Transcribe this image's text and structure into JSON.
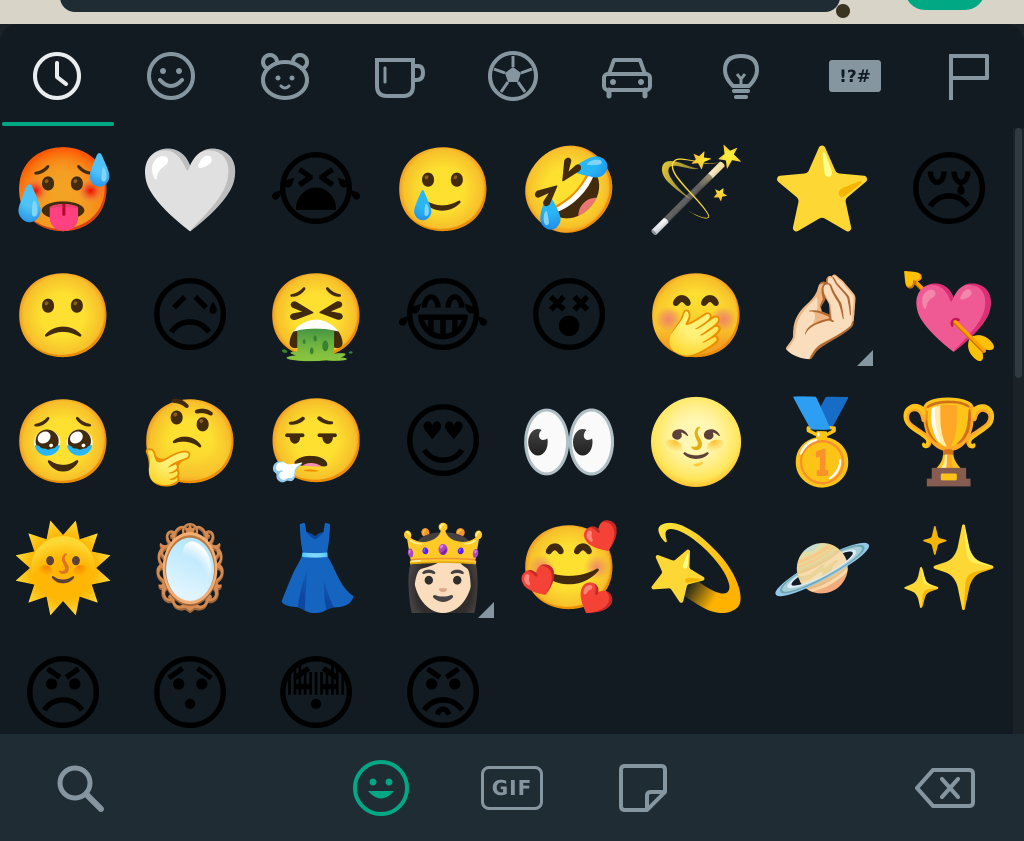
{
  "colors": {
    "background": "#111b21",
    "icon_inactive": "#8696a0",
    "icon_active": "#e9edef",
    "accent": "#00a884",
    "bottom_bar": "#1f2c33"
  },
  "category_tabs": [
    {
      "icon": "recent-clock-icon",
      "active": true
    },
    {
      "icon": "smileys-icon",
      "active": false
    },
    {
      "icon": "animals-icon",
      "active": false
    },
    {
      "icon": "food-cup-icon",
      "active": false
    },
    {
      "icon": "activity-ball-icon",
      "active": false
    },
    {
      "icon": "travel-car-icon",
      "active": false
    },
    {
      "icon": "objects-bulb-icon",
      "active": false
    },
    {
      "icon": "symbols-icon",
      "active": false,
      "label": "!?#"
    },
    {
      "icon": "flags-icon",
      "active": false
    }
  ],
  "recent_emojis": [
    {
      "char": "🥵",
      "name": "hot-face"
    },
    {
      "char": "🤍",
      "name": "white-heart"
    },
    {
      "char": "😭",
      "name": "loudly-crying-face"
    },
    {
      "char": "🥲",
      "name": "smiling-face-with-tear"
    },
    {
      "char": "🤣",
      "name": "rolling-on-floor-laughing"
    },
    {
      "char": "🪄",
      "name": "magic-wand"
    },
    {
      "char": "⭐",
      "name": "star"
    },
    {
      "char": "😢",
      "name": "crying-face"
    },
    {
      "char": "🙁",
      "name": "slightly-frowning-face"
    },
    {
      "char": "😥",
      "name": "sad-relieved-face"
    },
    {
      "char": "🤮",
      "name": "vomiting-face"
    },
    {
      "char": "😂",
      "name": "face-with-tears-of-joy"
    },
    {
      "char": "😵",
      "name": "face-with-crossed-out-eyes"
    },
    {
      "char": "🤭",
      "name": "face-with-hand-over-mouth"
    },
    {
      "char": "🤌🏻",
      "name": "pinched-fingers",
      "variants": true
    },
    {
      "char": "💘",
      "name": "heart-with-arrow"
    },
    {
      "char": "🥹",
      "name": "face-holding-back-tears"
    },
    {
      "char": "🤔",
      "name": "thinking-face"
    },
    {
      "char": "😮‍💨",
      "name": "face-exhaling"
    },
    {
      "char": "😍",
      "name": "smiling-face-with-heart-eyes"
    },
    {
      "char": "👀",
      "name": "eyes"
    },
    {
      "char": "🌝",
      "name": "full-moon-face"
    },
    {
      "char": "🥇",
      "name": "first-place-medal"
    },
    {
      "char": "🏆",
      "name": "trophy"
    },
    {
      "char": "🌞",
      "name": "sun-with-face"
    },
    {
      "char": "🪞",
      "name": "mirror"
    },
    {
      "char": "👗",
      "name": "dress"
    },
    {
      "char": "👸🏻",
      "name": "princess",
      "variants": true
    },
    {
      "char": "🥰",
      "name": "smiling-face-with-hearts"
    },
    {
      "char": "💫",
      "name": "dizzy"
    },
    {
      "char": "🪐",
      "name": "ringed-planet"
    },
    {
      "char": "✨",
      "name": "sparkles"
    },
    {
      "char": "😠",
      "name": "angry-face"
    },
    {
      "char": "😯",
      "name": "hushed-face"
    },
    {
      "char": "😳",
      "name": "flushed-face"
    },
    {
      "char": "😡",
      "name": "pouting-face"
    }
  ],
  "bottom_bar": {
    "search_icon": "search-icon",
    "emoji_icon": "emoji-tab-icon",
    "gif_label": "GIF",
    "sticker_icon": "sticker-icon",
    "backspace_icon": "backspace-icon"
  }
}
